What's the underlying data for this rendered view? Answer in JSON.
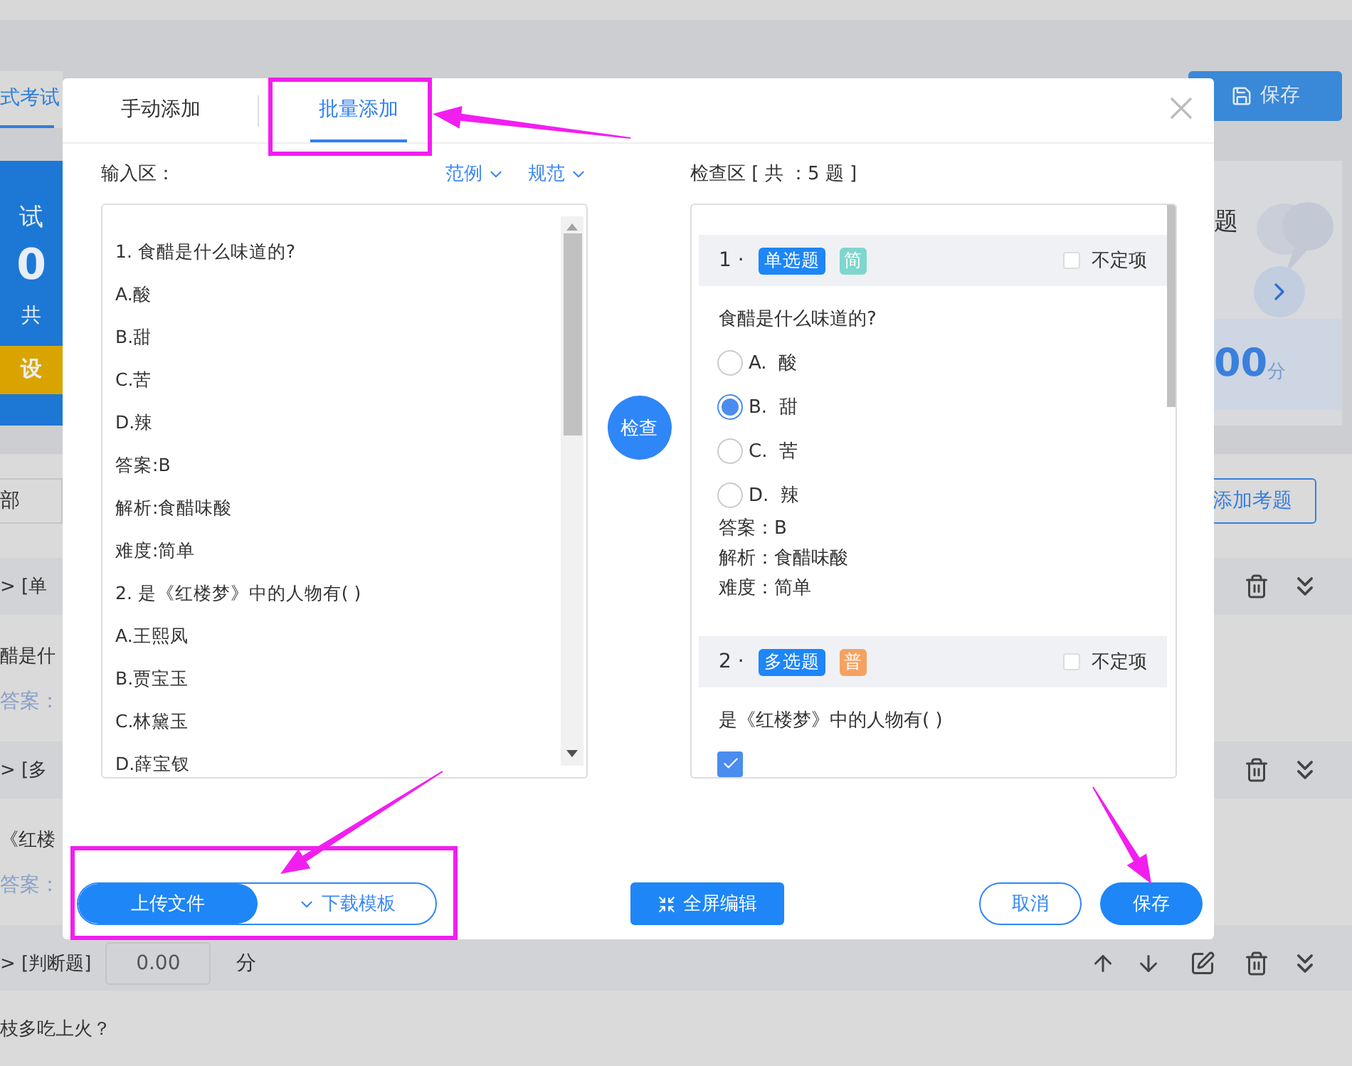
{
  "background": {
    "tab": "式考试",
    "save_button": "保存",
    "summary_card": {
      "title": "试",
      "count": "0",
      "caption": "共",
      "action": "设"
    },
    "score_card": {
      "title": "题",
      "score": "00",
      "unit": "分"
    },
    "filter": "部",
    "add_button": "添加考题",
    "questions": [
      {
        "type_label": "> [单",
        "text": "醋是什",
        "answer_label": "答案：",
        "covered": true
      },
      {
        "type_label": "> [多",
        "text": "《红楼",
        "answer_label": "答案：",
        "covered": true
      },
      {
        "type_label": "> [判断题]",
        "score": "0.00",
        "unit": "分",
        "text": "枝多吃上火？",
        "covered": false
      }
    ]
  },
  "dialog": {
    "tabs": [
      {
        "label": "手动添加",
        "selected": false
      },
      {
        "label": "批量添加",
        "selected": true
      }
    ],
    "input_label": "输入区：",
    "links": [
      "范例",
      "规范"
    ],
    "input_lines": [
      "1. 食醋是什么味道的?",
      "A.酸",
      "B.甜",
      "C.苦",
      "D.辣",
      "答案:B",
      "解析:食醋味酸",
      "难度:简单",
      "2. 是《红楼梦》中的人物有( )",
      "A.王熙凤",
      "B.贾宝玉",
      "C.林黛玉",
      "D.薛宝钗"
    ],
    "check_button": "检查",
    "preview_label": "检查区 [ 共 ：5 题 ]",
    "preview_questions": [
      {
        "number": "1 ·",
        "type": "单选题",
        "difficulty": "简",
        "color": "#7fd6cc",
        "uncertain_label": "不定项",
        "uncertain_checked": false,
        "text": "食醋是什么味道的?",
        "kind": "single",
        "options": [
          {
            "label": "A.",
            "text": "酸",
            "selected": false
          },
          {
            "label": "B.",
            "text": "甜",
            "selected": true
          },
          {
            "label": "C.",
            "text": "苦",
            "selected": false
          },
          {
            "label": "D.",
            "text": "辣",
            "selected": false
          }
        ],
        "answer": "答案：B",
        "analysis": "解析：食醋味酸",
        "level_text": "难度：简单"
      },
      {
        "number": "2 ·",
        "type": "多选题",
        "difficulty": "普",
        "color": "#f5a261",
        "uncertain_label": "不定项",
        "uncertain_checked": false,
        "text": "是《红楼梦》中的人物有( )",
        "kind": "multiple",
        "options": [
          {
            "checked": true
          }
        ]
      }
    ],
    "upload_button": "上传文件",
    "download_button": "下载模板",
    "fullscreen_button": "全屏编辑",
    "cancel_button": "取消",
    "save_button": "保存"
  },
  "annotations": [
    {
      "kind": "box"
    },
    {
      "kind": "arrow"
    },
    {
      "kind": "box"
    },
    {
      "kind": "arrow"
    },
    {
      "kind": "arrow"
    }
  ]
}
